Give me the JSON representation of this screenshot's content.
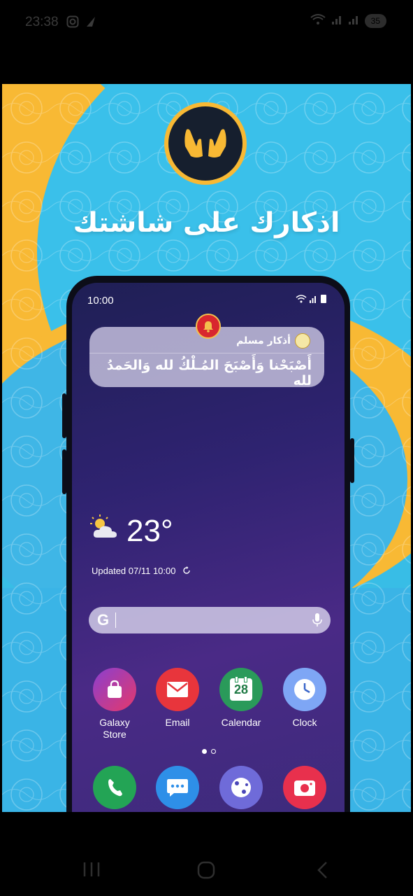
{
  "status_bar": {
    "time": "23:38",
    "battery": "35",
    "icons": [
      "instagram-icon",
      "send-icon",
      "wifi-icon",
      "signal-icon",
      "signal-icon",
      "battery-icon"
    ]
  },
  "promo": {
    "title": "اذكارك على شاشتك",
    "logo_icon": "praying-hands-icon",
    "colors": {
      "background_blue": "#38bde6",
      "accent_yellow": "#f8b934",
      "logo_dark": "#161f2e"
    }
  },
  "phone": {
    "time": "10:00",
    "notification": {
      "app_name": "أذكار مسلم",
      "text": "أَصْبَحْنا وَأَصْبَحَ المُـلْكُ لله وَالحَمدُ لله"
    },
    "weather": {
      "temperature": "23°",
      "updated": "Updated 07/11 10:00",
      "icon": "partly-cloudy-icon"
    },
    "search": {
      "logo": "G",
      "mic_icon": "mic-icon"
    },
    "apps": [
      {
        "label": "Galaxy Store",
        "icon": "shopping-bag-icon"
      },
      {
        "label": "Email",
        "icon": "envelope-icon"
      },
      {
        "label": "Calendar",
        "icon": "calendar-icon",
        "day": "28"
      },
      {
        "label": "Clock",
        "icon": "clock-icon"
      }
    ],
    "dock": [
      {
        "icon": "phone-icon"
      },
      {
        "icon": "messages-icon"
      },
      {
        "icon": "internet-icon"
      },
      {
        "icon": "camera-icon"
      }
    ]
  },
  "nav_bar": {
    "icons": [
      "recents-icon",
      "home-icon",
      "back-icon"
    ]
  }
}
